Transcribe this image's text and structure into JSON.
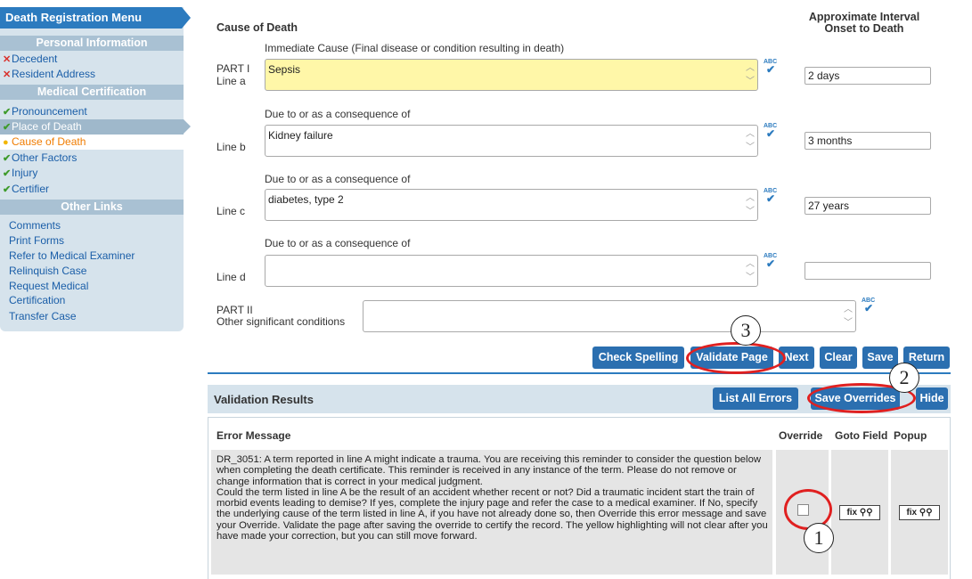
{
  "sidebar": {
    "title": "Death Registration Menu",
    "sections": {
      "personal": "Personal Information",
      "medical": "Medical Certification",
      "other": "Other Links"
    },
    "personal_items": [
      {
        "label": "Decedent",
        "status": "error"
      },
      {
        "label": "Resident Address",
        "status": "error"
      }
    ],
    "medical_items": [
      {
        "label": "Pronouncement",
        "status": "complete"
      },
      {
        "label": "Place of Death",
        "status": "complete"
      },
      {
        "label": "Cause of Death",
        "status": "current"
      },
      {
        "label": "Other Factors",
        "status": "complete"
      },
      {
        "label": "Injury",
        "status": "complete"
      },
      {
        "label": "Certifier",
        "status": "complete"
      }
    ],
    "other_links": [
      "Comments",
      "Print Forms",
      "Refer to Medical Examiner",
      "Relinquish Case",
      "Request Medical Certification",
      "Transfer Case"
    ]
  },
  "form": {
    "title": "Cause of Death",
    "interval_header": "Approximate Interval Onset to Death",
    "immediate_label": "Immediate Cause (Final disease or condition resulting in death)",
    "due_to": "Due to or as a consequence of",
    "line_a_label": "PART I\nLine a",
    "line_b_label": "Line b",
    "line_c_label": "Line c",
    "line_d_label": "Line d",
    "part2_label": "PART II\nOther significant conditions",
    "line_a_value": "Sepsis",
    "line_b_value": "Kidney failure",
    "line_c_value": "diabetes, type 2",
    "line_d_value": "",
    "part2_value": "",
    "interval_a": "2 days",
    "interval_b": "3 months",
    "interval_c": "27 years",
    "interval_d": "",
    "spell_icon_text": "ABC"
  },
  "buttons": {
    "check_spelling": "Check Spelling",
    "validate_page": "Validate Page",
    "next": "Next",
    "clear": "Clear",
    "save": "Save",
    "return": "Return"
  },
  "validation": {
    "title": "Validation Results",
    "list_all_errors": "List All Errors",
    "save_overrides": "Save Overrides",
    "hide": "Hide",
    "columns": [
      "Error Message",
      "Override",
      "Goto Field",
      "Popup"
    ],
    "error_message": "DR_3051:  A term reported in line A might indicate a trauma. You are receiving this reminder to consider the question below when completing the death certificate. This reminder is received in any instance of the term. Please do not remove or change information that is correct in your medical judgment.\nCould the term listed in line A be the result of an accident whether recent or not? Did a traumatic incident start the train of morbid events leading to demise? If yes, complete the injury page and refer the case to a medical examiner. If No, specify the underlying cause of the term listed in line A, if you have not already done so, then Override this error message and save your Override. Validate the page after saving the override to certify the record. The yellow highlighting will not clear after you have made your correction, but you can still move forward.",
    "fix_label": "fix",
    "override_checked": false
  },
  "annotations": [
    "1",
    "2",
    "3"
  ]
}
